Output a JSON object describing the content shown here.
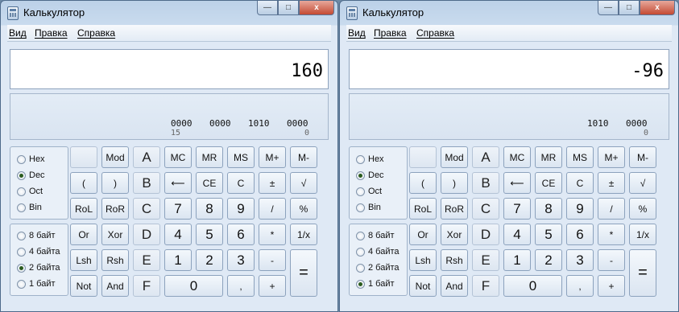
{
  "windows": [
    {
      "title": "Калькулятор",
      "menu": [
        "Вид",
        "Правка",
        "Справка"
      ],
      "display": "160",
      "bits": [
        "0000",
        "0000",
        "1010",
        "0000"
      ],
      "bit_index": [
        "15",
        "0"
      ],
      "base_options": [
        "Hex",
        "Dec",
        "Oct",
        "Bin"
      ],
      "base_selected": "Dec",
      "size_options": [
        "8 байт",
        "4 байта",
        "2 байта",
        "1 байт"
      ],
      "size_selected": "2 байта"
    },
    {
      "title": "Калькулятор",
      "menu": [
        "Вид",
        "Правка",
        "Справка"
      ],
      "display": "-96",
      "bits": [
        "",
        "",
        "1010",
        "0000"
      ],
      "bit_index": [
        "",
        "0"
      ],
      "base_options": [
        "Hex",
        "Dec",
        "Oct",
        "Bin"
      ],
      "base_selected": "Dec",
      "size_options": [
        "8 байт",
        "4 байта",
        "2 байта",
        "1 байт"
      ],
      "size_selected": "1 байт"
    }
  ],
  "keys": {
    "row1": [
      "",
      "Mod",
      "A",
      "MC",
      "MR",
      "MS",
      "M+",
      "M-"
    ],
    "row2": [
      "(",
      ")",
      "B",
      "⟵",
      "CE",
      "C",
      "±",
      "√"
    ],
    "row3": [
      "RoL",
      "RoR",
      "C",
      "7",
      "8",
      "9",
      "/",
      "%"
    ],
    "row4": [
      "Or",
      "Xor",
      "D",
      "4",
      "5",
      "6",
      "*",
      "1/x"
    ],
    "row5": [
      "Lsh",
      "Rsh",
      "E",
      "1",
      "2",
      "3",
      "-"
    ],
    "row6": [
      "Not",
      "And",
      "F",
      "0",
      ",",
      "+"
    ],
    "equals": "="
  },
  "window_controls": {
    "minimize": "—",
    "maximize": "□",
    "close": "x"
  }
}
